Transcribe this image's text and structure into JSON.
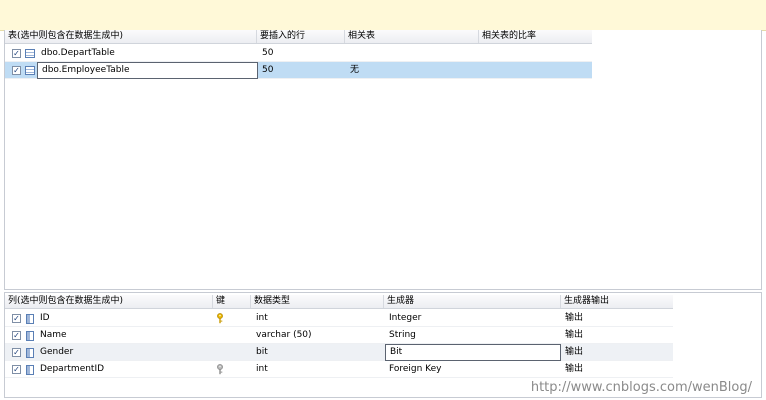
{
  "tables_grid": {
    "headers": [
      "表(选中则包含在数据生成中)",
      "要插入的行",
      "相关表",
      "相关表的比率"
    ],
    "rows": [
      {
        "name": "dbo.DepartTable",
        "rows_to_insert": "50",
        "related_table": "",
        "ratio": ""
      },
      {
        "name": "dbo.EmployeeTable",
        "rows_to_insert": "50",
        "related_table": "无",
        "ratio": ""
      }
    ]
  },
  "columns_grid": {
    "headers": [
      "列(选中则包含在数据生成中)",
      "键",
      "数据类型",
      "生成器",
      "生成器输出"
    ],
    "rows": [
      {
        "name": "ID",
        "data_type": "int",
        "generator": "Integer",
        "output": "输出",
        "key": "primary-key-icon"
      },
      {
        "name": "Name",
        "data_type": "varchar (50)",
        "generator": "String",
        "output": "输出"
      },
      {
        "name": "Gender",
        "data_type": "bit",
        "generator": "Bit",
        "output": "输出"
      },
      {
        "name": "DepartmentID",
        "data_type": "int",
        "generator": "Foreign Key",
        "output": "输出",
        "key": "foreign-key-icon"
      }
    ]
  },
  "checkbox_mark": "✓",
  "watermark": "http://www.cnblogs.com/wenBlog/",
  "colors": {
    "selection": "#bfdcf4",
    "info_bar": "#fff9d8",
    "primary_key": "#e8b400",
    "foreign_key": "#9a9a9a"
  }
}
